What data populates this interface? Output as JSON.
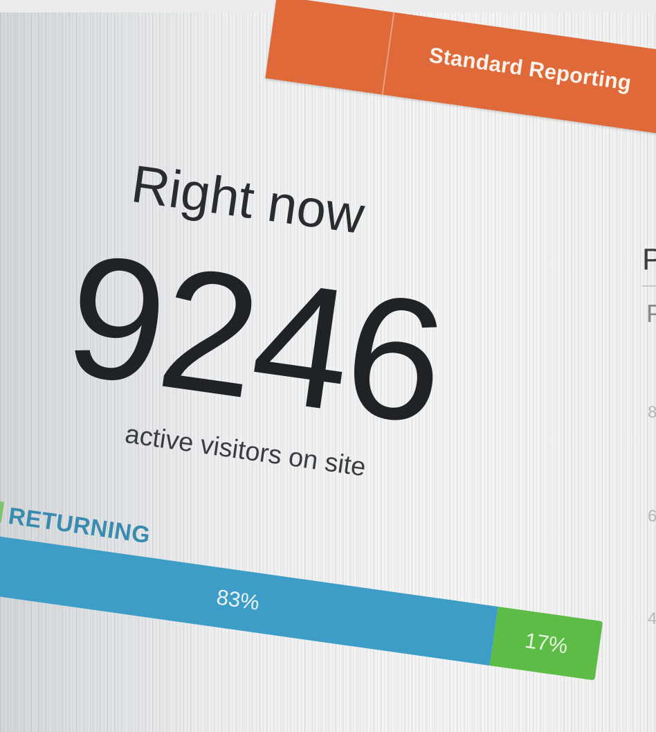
{
  "header": {
    "title": "Standard Reporting"
  },
  "realtime": {
    "heading": "Right now",
    "active_count": "9246",
    "subtitle": "active visitors on site"
  },
  "visitor_split": {
    "legend_label": "RETURNING",
    "returning": {
      "value": 83,
      "label": "83%",
      "color": "#3e9dc6"
    },
    "new": {
      "value": 17,
      "label": "17%",
      "color": "#5cbc46"
    }
  },
  "right_panel": {
    "title_fragment": "P",
    "subtitle_fragment": "P",
    "ticks": [
      "8",
      "6",
      "4"
    ]
  }
}
